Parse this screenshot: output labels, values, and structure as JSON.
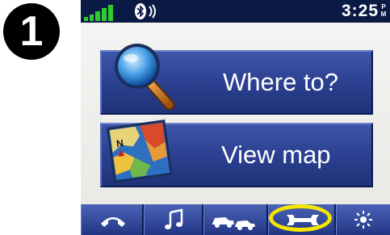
{
  "step_badge": "1",
  "status_bar": {
    "time": "3:25",
    "time_suffix": "PM",
    "icons": [
      "signal-strength-icon",
      "bluetooth-icon",
      "phone-connected-icon"
    ]
  },
  "main_menu": {
    "where_to": {
      "label": "Where to?",
      "icon": "magnifier-icon"
    },
    "view_map": {
      "label": "View map",
      "icon": "map-icon"
    }
  },
  "toolbar": {
    "items": [
      {
        "name": "phone",
        "icon": "phone-handset-icon"
      },
      {
        "name": "music",
        "icon": "music-note-icon"
      },
      {
        "name": "traffic",
        "icon": "traffic-cars-icon"
      },
      {
        "name": "tools",
        "icon": "wrench-icon",
        "highlighted": true
      },
      {
        "name": "brightness",
        "icon": "brightness-sun-icon"
      }
    ]
  },
  "colors": {
    "button_blue": "#2d4293",
    "status_bar": "#0b1a45",
    "highlight": "#f4e600",
    "signal_green": "#2ecc2e"
  }
}
